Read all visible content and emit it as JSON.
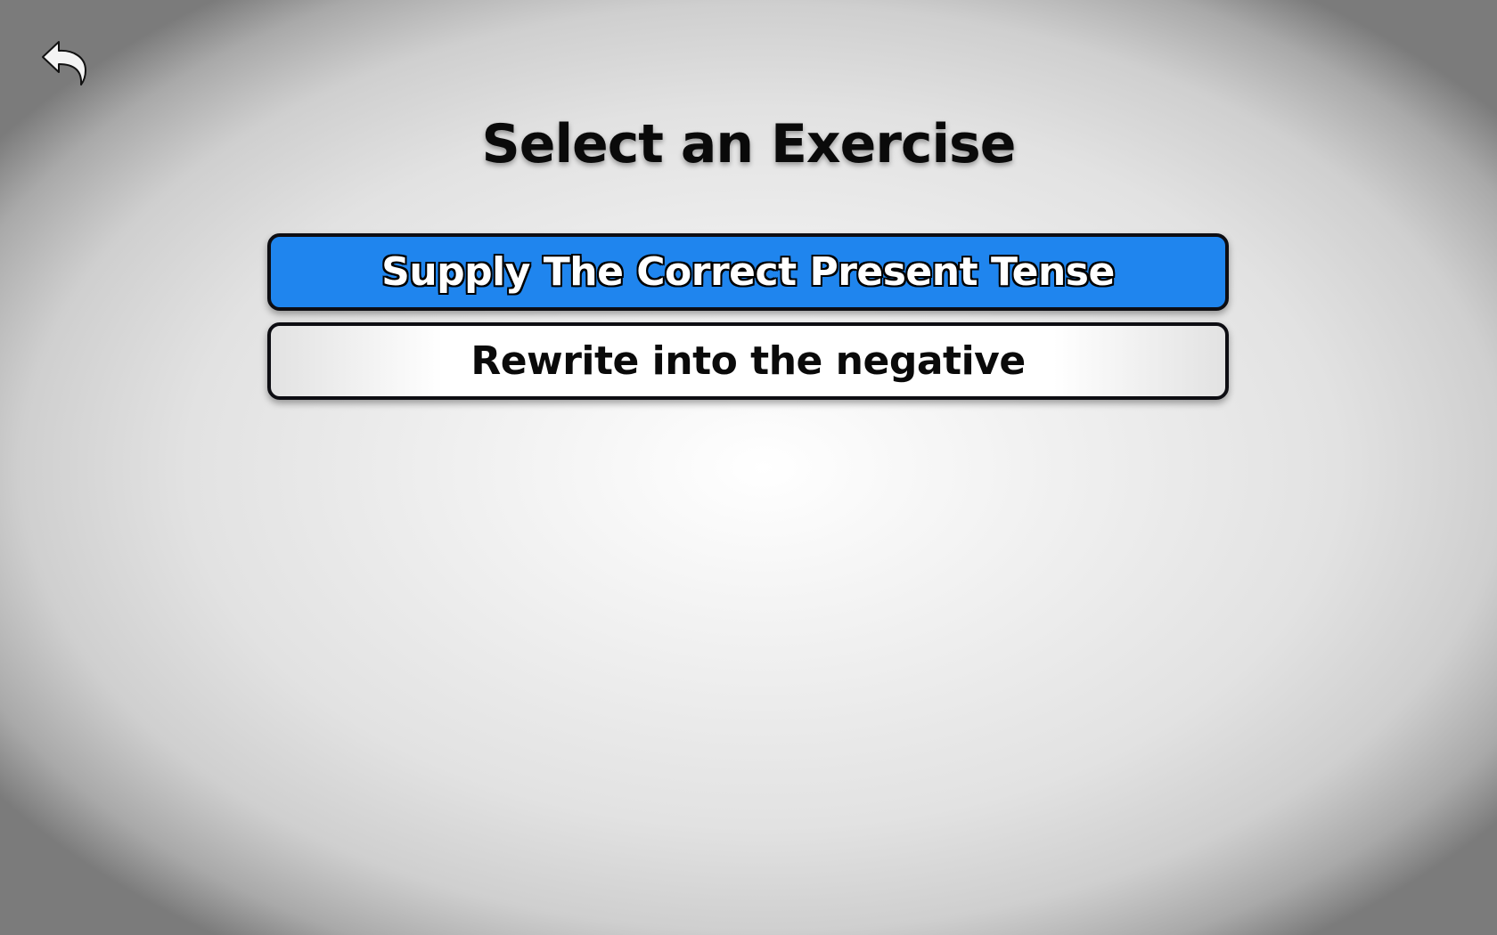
{
  "back": {
    "icon": "undo-arrow-icon"
  },
  "header": {
    "title": "Select an Exercise"
  },
  "exercises": [
    {
      "label": "Supply The Correct Present Tense",
      "selected": true
    },
    {
      "label": "Rewrite into the negative",
      "selected": false
    }
  ],
  "colors": {
    "selected_bg": "#1f85ee",
    "border": "#0d0d12",
    "text": "#0a0a0a"
  }
}
